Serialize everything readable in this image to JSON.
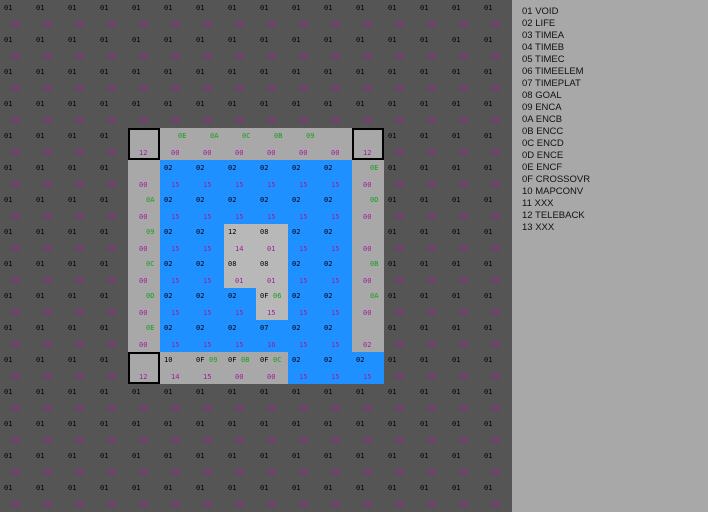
{
  "colors": {
    "blank": "#555555",
    "floor": "#a8a8a8",
    "water": "#1e90ff",
    "lightfloor": "#b8b8b8",
    "text_black": "#000000",
    "text_green": "#1a9e1a",
    "text_magenta": "#a21aa2"
  },
  "map": {
    "cols": 16,
    "rows": 16,
    "default_cell": {
      "top": "01",
      "bottom": "00",
      "bg": "blank"
    },
    "cells": [
      {
        "r": 4,
        "c": 4,
        "bg": "floor",
        "top": "",
        "bottom": "12"
      },
      {
        "r": 4,
        "c": 5,
        "bg": "floor",
        "top": "0E",
        "tc": "green",
        "bottom": "00"
      },
      {
        "r": 4,
        "c": 6,
        "bg": "floor",
        "top": "0A",
        "tc": "green",
        "bottom": "00"
      },
      {
        "r": 4,
        "c": 7,
        "bg": "floor",
        "top": "0C",
        "tc": "green",
        "bottom": "00"
      },
      {
        "r": 4,
        "c": 8,
        "bg": "floor",
        "top": "0B",
        "tc": "green",
        "bottom": "00"
      },
      {
        "r": 4,
        "c": 9,
        "bg": "floor",
        "top": "09",
        "tc": "green",
        "bottom": "00"
      },
      {
        "r": 4,
        "c": 10,
        "bg": "floor",
        "top": "",
        "bottom": "00"
      },
      {
        "r": 4,
        "c": 11,
        "bg": "floor",
        "top": "",
        "bottom": "12"
      },
      {
        "r": 5,
        "c": 4,
        "bg": "floor",
        "top": "",
        "bottom": "00"
      },
      {
        "r": 5,
        "c": 5,
        "bg": "water",
        "top": "02",
        "bottom": "15"
      },
      {
        "r": 5,
        "c": 6,
        "bg": "water",
        "top": "02",
        "bottom": "15"
      },
      {
        "r": 5,
        "c": 7,
        "bg": "water",
        "top": "02",
        "bottom": "15"
      },
      {
        "r": 5,
        "c": 8,
        "bg": "water",
        "top": "02",
        "bottom": "15"
      },
      {
        "r": 5,
        "c": 9,
        "bg": "water",
        "top": "02",
        "bottom": "15"
      },
      {
        "r": 5,
        "c": 10,
        "bg": "water",
        "top": "02",
        "bottom": "15"
      },
      {
        "r": 5,
        "c": 11,
        "bg": "floor",
        "top": "0E",
        "tc": "green",
        "bottom": "00"
      },
      {
        "r": 6,
        "c": 4,
        "bg": "floor",
        "top": "0A",
        "tc": "green",
        "bottom": "00"
      },
      {
        "r": 6,
        "c": 5,
        "bg": "water",
        "top": "02",
        "bottom": "15"
      },
      {
        "r": 6,
        "c": 6,
        "bg": "water",
        "top": "02",
        "bottom": "15"
      },
      {
        "r": 6,
        "c": 7,
        "bg": "water",
        "top": "02",
        "bottom": "15"
      },
      {
        "r": 6,
        "c": 8,
        "bg": "water",
        "top": "02",
        "bottom": "15"
      },
      {
        "r": 6,
        "c": 9,
        "bg": "water",
        "top": "02",
        "bottom": "15"
      },
      {
        "r": 6,
        "c": 10,
        "bg": "water",
        "top": "02",
        "bottom": "15"
      },
      {
        "r": 6,
        "c": 11,
        "bg": "floor",
        "top": "0D",
        "tc": "green",
        "bottom": "00"
      },
      {
        "r": 7,
        "c": 4,
        "bg": "floor",
        "top": "09",
        "tc": "green",
        "bottom": "00"
      },
      {
        "r": 7,
        "c": 5,
        "bg": "water",
        "top": "02",
        "bottom": "15"
      },
      {
        "r": 7,
        "c": 6,
        "bg": "water",
        "top": "02",
        "bottom": "15"
      },
      {
        "r": 7,
        "c": 7,
        "bg": "lightfloor",
        "top": "12",
        "bottom": "14"
      },
      {
        "r": 7,
        "c": 8,
        "bg": "lightfloor",
        "top": "08",
        "bottom": "01"
      },
      {
        "r": 7,
        "c": 9,
        "bg": "water",
        "top": "02",
        "bottom": "15"
      },
      {
        "r": 7,
        "c": 10,
        "bg": "water",
        "top": "02",
        "bottom": "15"
      },
      {
        "r": 7,
        "c": 11,
        "bg": "floor",
        "top": "",
        "bottom": "00"
      },
      {
        "r": 8,
        "c": 4,
        "bg": "floor",
        "top": "0C",
        "tc": "green",
        "bottom": "00"
      },
      {
        "r": 8,
        "c": 5,
        "bg": "water",
        "top": "02",
        "bottom": "15"
      },
      {
        "r": 8,
        "c": 6,
        "bg": "water",
        "top": "02",
        "bottom": "15"
      },
      {
        "r": 8,
        "c": 7,
        "bg": "lightfloor",
        "top": "08",
        "bottom": "01"
      },
      {
        "r": 8,
        "c": 8,
        "bg": "lightfloor",
        "top": "08",
        "bottom": "01"
      },
      {
        "r": 8,
        "c": 9,
        "bg": "water",
        "top": "02",
        "bottom": "15"
      },
      {
        "r": 8,
        "c": 10,
        "bg": "water",
        "top": "02",
        "bottom": "15"
      },
      {
        "r": 8,
        "c": 11,
        "bg": "floor",
        "top": "0B",
        "tc": "green",
        "bottom": "00"
      },
      {
        "r": 9,
        "c": 4,
        "bg": "floor",
        "top": "0D",
        "tc": "green",
        "bottom": "00"
      },
      {
        "r": 9,
        "c": 5,
        "bg": "water",
        "top": "02",
        "bottom": "15"
      },
      {
        "r": 9,
        "c": 6,
        "bg": "water",
        "top": "02",
        "bottom": "15"
      },
      {
        "r": 9,
        "c": 7,
        "bg": "water",
        "top": "02",
        "bottom": "15"
      },
      {
        "r": 9,
        "c": 8,
        "bg": "lightfloor",
        "top": "0F",
        "top2": "06",
        "tc2": "green",
        "bottom": "15"
      },
      {
        "r": 9,
        "c": 9,
        "bg": "water",
        "top": "02",
        "bottom": "15"
      },
      {
        "r": 9,
        "c": 10,
        "bg": "water",
        "top": "02",
        "bottom": "15"
      },
      {
        "r": 9,
        "c": 11,
        "bg": "floor",
        "top": "0A",
        "tc": "green",
        "bottom": "00"
      },
      {
        "r": 10,
        "c": 4,
        "bg": "floor",
        "top": "0E",
        "tc": "green",
        "bottom": "00"
      },
      {
        "r": 10,
        "c": 5,
        "bg": "water",
        "top": "02",
        "bottom": "15"
      },
      {
        "r": 10,
        "c": 6,
        "bg": "water",
        "top": "02",
        "bottom": "15"
      },
      {
        "r": 10,
        "c": 7,
        "bg": "water",
        "top": "02",
        "bottom": "15"
      },
      {
        "r": 10,
        "c": 8,
        "bg": "water",
        "top": "07",
        "bottom": "16"
      },
      {
        "r": 10,
        "c": 9,
        "bg": "water",
        "top": "02",
        "bottom": "15"
      },
      {
        "r": 10,
        "c": 10,
        "bg": "water",
        "top": "02",
        "bottom": "15"
      },
      {
        "r": 10,
        "c": 11,
        "bg": "floor",
        "top": "",
        "bottom": "02"
      },
      {
        "r": 11,
        "c": 4,
        "bg": "floor",
        "top": "",
        "bottom": "12"
      },
      {
        "r": 11,
        "c": 5,
        "bg": "floor",
        "top": "10",
        "bottom": "14"
      },
      {
        "r": 11,
        "c": 6,
        "bg": "floor",
        "top": "0F",
        "top2": "09",
        "tc2": "green",
        "bottom": "15"
      },
      {
        "r": 11,
        "c": 7,
        "bg": "floor",
        "top": "0F",
        "top2": "0B",
        "tc2": "green",
        "bottom": "00"
      },
      {
        "r": 11,
        "c": 8,
        "bg": "floor",
        "top": "0F",
        "top2": "0C",
        "tc2": "green",
        "bottom": "00"
      },
      {
        "r": 11,
        "c": 9,
        "bg": "water",
        "top": "02",
        "bottom": "15"
      },
      {
        "r": 11,
        "c": 10,
        "bg": "water",
        "top": "02",
        "bottom": "15"
      },
      {
        "r": 11,
        "c": 11,
        "bg": "water",
        "top": "02",
        "bottom": "15"
      }
    ],
    "boxes": [
      [
        4,
        4,
        1,
        1
      ],
      [
        4,
        11,
        1,
        1
      ],
      [
        11,
        4,
        1,
        1
      ]
    ]
  },
  "legend": [
    "01 VOID",
    "02 LIFE",
    "03 TIMEA",
    "04 TIMEB",
    "05 TIMEC",
    "06 TIMEELEM",
    "07 TIMEPLAT",
    "08 GOAL",
    "09 ENCA",
    "0A ENCB",
    "0B ENCC",
    "0C ENCD",
    "0D ENCE",
    "0E ENCF",
    "0F CROSSOVR",
    "10 MAPCONV",
    "11 XXX",
    "12 TELEBACK",
    "13 XXX"
  ]
}
